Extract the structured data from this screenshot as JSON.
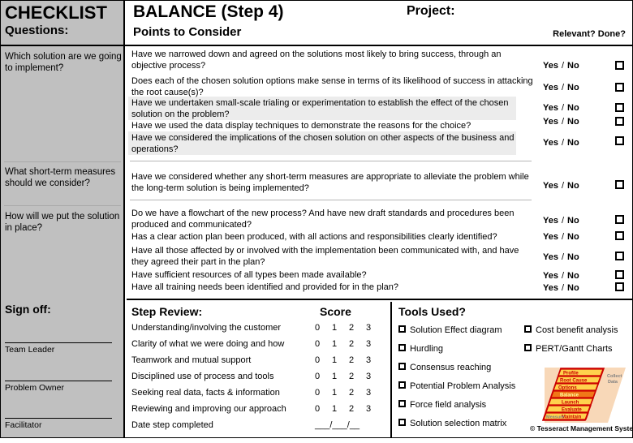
{
  "header": {
    "left_title": "CHECKLIST",
    "left_subtitle": "Questions:",
    "title": "BALANCE  (Step 4)",
    "subtitle": "Points to Consider",
    "project_label": "Project:",
    "relevant_done": "Relevant? Done?"
  },
  "sidebar": {
    "questions": [
      "Which solution are we going to implement?",
      "What short-term measures should we consider?",
      "How will we put the solution in place?"
    ],
    "signoff_title": "Sign off:",
    "signoff_roles": [
      "Team Leader",
      "Problem Owner",
      "Facilitator"
    ]
  },
  "main": {
    "yes_label": "Yes",
    "separator": "/",
    "no_label": "No",
    "groups": [
      {
        "rows": [
          {
            "text": "Have we narrowed down and agreed on the solutions most likely to bring success, through an objective process?",
            "shaded": false
          },
          {
            "text": "Does each of the chosen solution options make sense in terms of its likelihood of success in attacking the root cause(s)?",
            "shaded": false
          },
          {
            "text": "Have we undertaken small-scale trialing or experimentation to establish the effect of the chosen solution on the problem?",
            "shaded": true
          },
          {
            "text": "Have we used the data display techniques to demonstrate the reasons for the choice?",
            "shaded": false
          },
          {
            "text": "Have we considered the implications of the chosen solution on other aspects of the business and operations?",
            "shaded": true
          }
        ]
      },
      {
        "rows": [
          {
            "text": "Have we considered whether any short-term measures are appropriate to alleviate the problem while the long-term solution is being implemented?",
            "shaded": false
          }
        ]
      },
      {
        "rows": [
          {
            "text": "Do we have a flowchart of the new process?  And have new draft standards and procedures been produced and communicated?",
            "shaded": false
          },
          {
            "text": "Has a clear action plan been produced, with all actions and responsibilities clearly identified?",
            "shaded": false
          },
          {
            "text": "Have all those affected by or involved with the implementation been communicated with, and have they agreed their part in the plan?",
            "shaded": false
          },
          {
            "text": "Have sufficient resources of all types been made available?",
            "shaded": false
          },
          {
            "text": "Have all training needs been identified and provided for in the plan?",
            "shaded": false
          }
        ]
      }
    ]
  },
  "review": {
    "title": "Step Review:",
    "score_header": "Score",
    "score_options": [
      "0",
      "1",
      "2",
      "3"
    ],
    "items": [
      "Understanding/involving the customer",
      "Clarity of what we were doing and how",
      "Teamwork and mutual support",
      "Disciplined use of process and tools",
      "Seeking real data, facts & information",
      "Reviewing and improving our approach"
    ],
    "date_label": "Date step completed",
    "date_value": "___/___/__"
  },
  "tools": {
    "title": "Tools Used?",
    "left_column": [
      "Solution Effect diagram",
      "Hurdling",
      "Consensus reaching",
      "Potential Problem Analysis",
      "Force field analysis",
      "Solution selection matrix"
    ],
    "right_column": [
      "Cost benefit analysis",
      "PERT/Gantt Charts"
    ]
  },
  "logo": {
    "steps": [
      "Profile",
      "Root Cause",
      "Options",
      "Balance",
      "Launch",
      "Evaluate",
      "Maintain"
    ],
    "active_step": "Balance",
    "back_left_label": "Measure",
    "back_right_label": "Collect Data",
    "credit": "© Tesseract Management Systems",
    "colors": {
      "band": "#f8d8b8",
      "step": "#ffd24d",
      "active": "#f07818",
      "outline": "#cc0000",
      "step_text": "#cc0000"
    }
  }
}
